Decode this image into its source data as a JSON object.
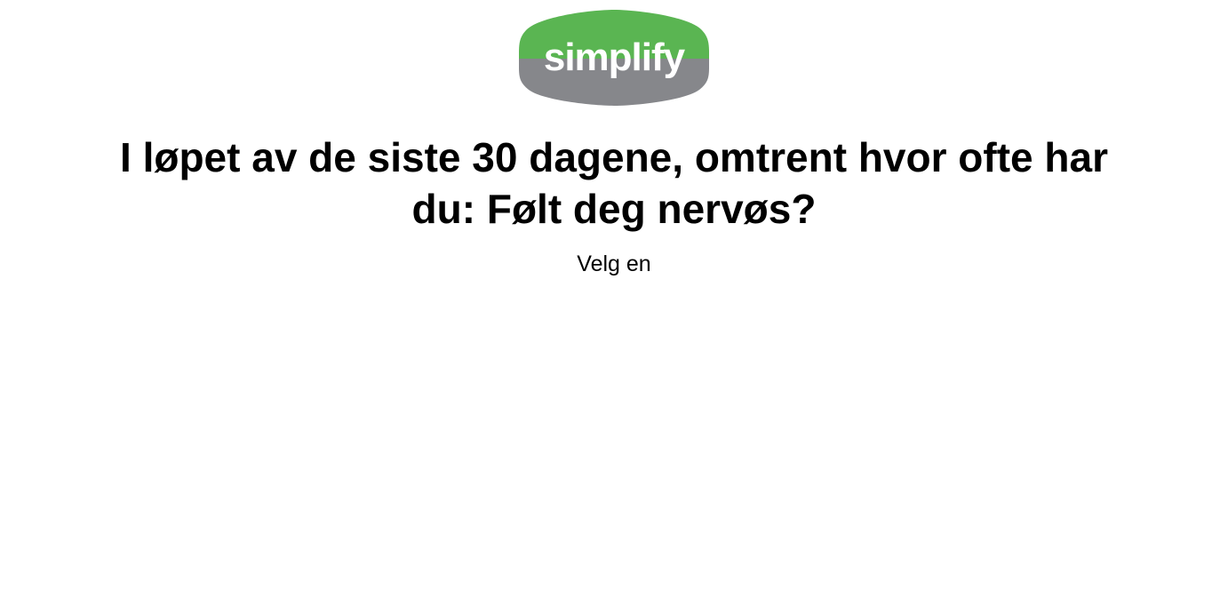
{
  "logo": {
    "text": "simplify",
    "colors": {
      "top": "#5ab552",
      "bottom": "#86878b",
      "text": "#ffffff"
    }
  },
  "question": {
    "text": "I løpet av de siste 30 dagene, omtrent hvor ofte har du: Følt deg nervøs?"
  },
  "instruction": {
    "text": "Velg en"
  }
}
